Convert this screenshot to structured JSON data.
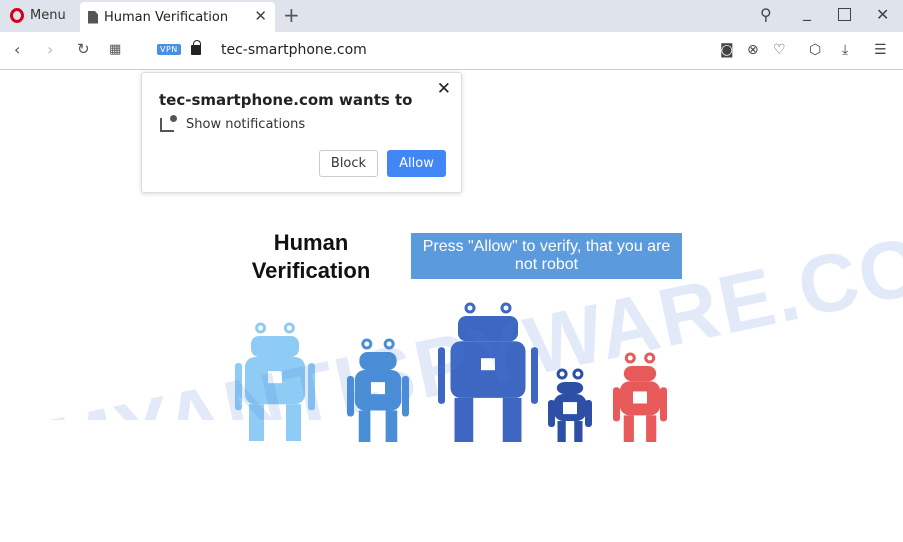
{
  "browser": {
    "menu_label": "Menu",
    "tab_title": "Human Verification",
    "url": "tec-smartphone.com",
    "vpn_badge": "VPN"
  },
  "popup": {
    "title": "tec-smartphone.com wants to",
    "permission": "Show notifications",
    "block_label": "Block",
    "allow_label": "Allow"
  },
  "page": {
    "heading": "Human Verification",
    "prompt": "Press \"Allow\" to verify, that you are not robot",
    "robot_colors": [
      "#8ecbf5",
      "#4a8fd6",
      "#3d67c0",
      "#2d4fa6",
      "#e85a5a"
    ]
  },
  "watermark": "MYANTISPYWARE.COM"
}
